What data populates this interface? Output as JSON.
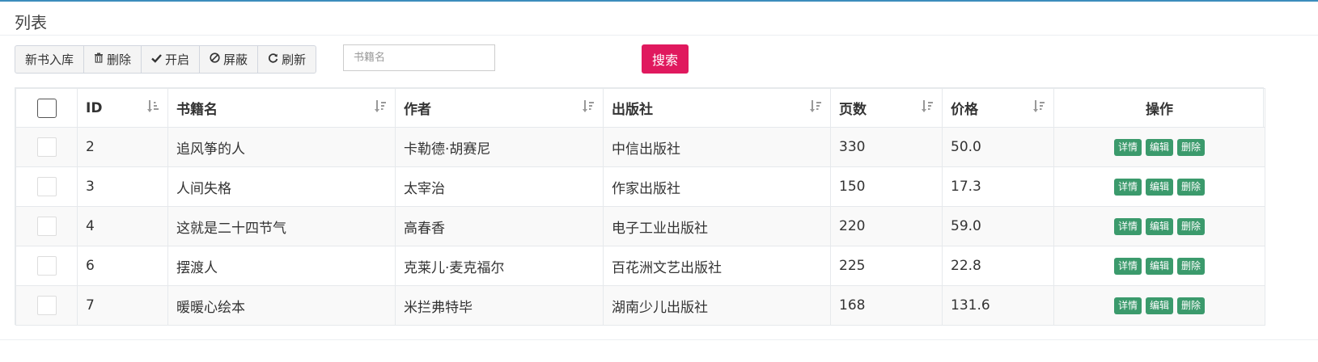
{
  "panel": {
    "title": "列表"
  },
  "toolbar": {
    "buttons": [
      {
        "label": "新书入库",
        "icon": ""
      },
      {
        "label": "删除",
        "icon": "trash-icon"
      },
      {
        "label": "开启",
        "icon": "check-icon"
      },
      {
        "label": "屏蔽",
        "icon": "ban-icon"
      },
      {
        "label": "刷新",
        "icon": "refresh-icon"
      }
    ]
  },
  "search": {
    "placeholder": "书籍名",
    "value": "",
    "button_label": "搜索"
  },
  "table": {
    "columns": [
      "ID",
      "书籍名",
      "作者",
      "出版社",
      "页数",
      "价格",
      "操作"
    ],
    "actions": [
      "详情",
      "编辑",
      "删除"
    ],
    "rows": [
      {
        "id": "2",
        "name": "追风筝的人",
        "author": "卡勒德·胡赛尼",
        "publisher": "中信出版社",
        "pages": "330",
        "price": "50.0"
      },
      {
        "id": "3",
        "name": "人间失格",
        "author": "太宰治",
        "publisher": "作家出版社",
        "pages": "150",
        "price": "17.3"
      },
      {
        "id": "4",
        "name": "这就是二十四节气",
        "author": "高春香",
        "publisher": "电子工业出版社",
        "pages": "220",
        "price": "59.0"
      },
      {
        "id": "6",
        "name": "摆渡人",
        "author": "克莱儿·麦克福尔",
        "publisher": "百花洲文艺出版社",
        "pages": "225",
        "price": "22.8"
      },
      {
        "id": "7",
        "name": "暖暖心绘本",
        "author": "米拦弗特毕",
        "publisher": "湖南少儿出版社",
        "pages": "168",
        "price": "131.6"
      }
    ]
  },
  "colors": {
    "accent": "#3c8dbc",
    "search_button": "#e0195e",
    "action_button": "#3b9a6c"
  }
}
